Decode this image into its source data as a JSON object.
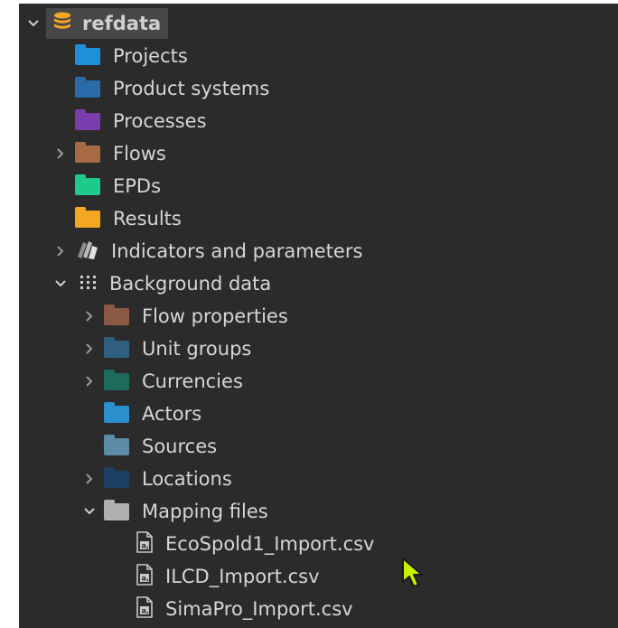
{
  "tree": {
    "root": {
      "label": "refdata",
      "icon": "database-icon",
      "color": "#f5a623"
    },
    "items": [
      {
        "label": "Projects",
        "color": "#1e8fd8"
      },
      {
        "label": "Product systems",
        "color": "#2a6aa8"
      },
      {
        "label": "Processes",
        "color": "#7b3cae"
      },
      {
        "label": "Flows",
        "color": "#a66a45"
      },
      {
        "label": "EPDs",
        "color": "#1ec98c"
      },
      {
        "label": "Results",
        "color": "#f5a623"
      },
      {
        "label": "Indicators and parameters",
        "icon": "indicators-icon"
      },
      {
        "label": "Background data",
        "icon": "grid-dots-icon"
      },
      {
        "label": "Flow properties",
        "color": "#8a5a44"
      },
      {
        "label": "Unit groups",
        "color": "#2f6080"
      },
      {
        "label": "Currencies",
        "color": "#1d6b5a"
      },
      {
        "label": "Actors",
        "color": "#2a8fcc"
      },
      {
        "label": "Sources",
        "color": "#5c8ca8"
      },
      {
        "label": "Locations",
        "color": "#1c3f63"
      },
      {
        "label": "Mapping files",
        "color": "#b0b0b0"
      },
      {
        "label": "EcoSpold1_Import.csv",
        "icon": "csv-file-icon"
      },
      {
        "label": "ILCD_Import.csv",
        "icon": "csv-file-icon"
      },
      {
        "label": "SimaPro_Import.csv",
        "icon": "csv-file-icon"
      }
    ]
  },
  "colors": {
    "background": "#2b2b2b",
    "text": "#d6d6d6",
    "selection": "#474747",
    "cursor": "#c8f000"
  }
}
